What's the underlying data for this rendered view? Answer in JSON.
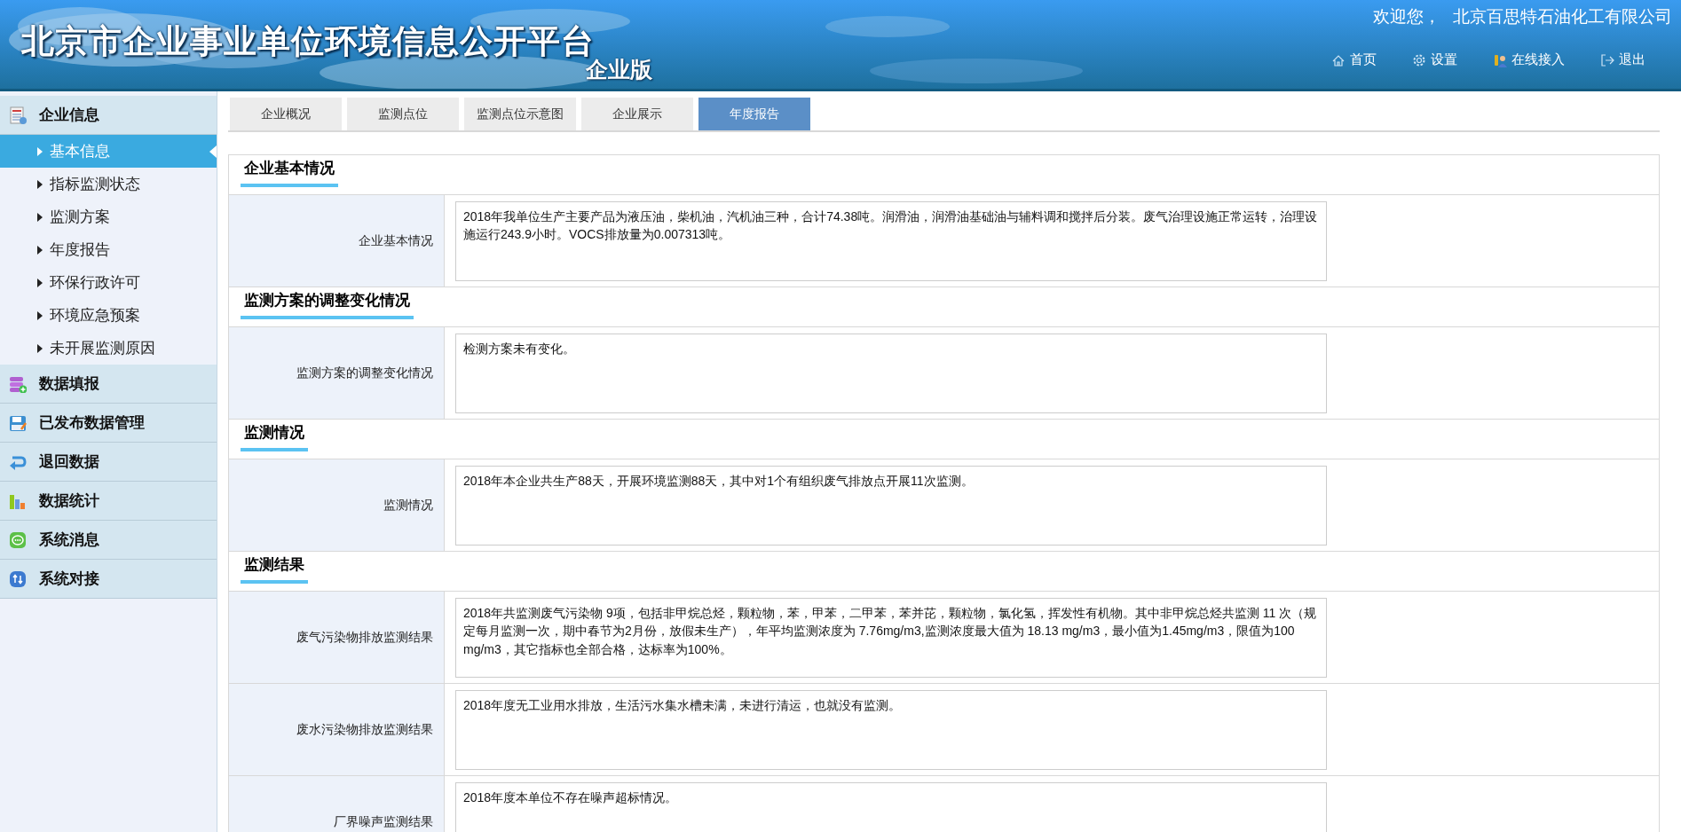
{
  "header": {
    "title": "北京市企业事业单位环境信息公开平台",
    "edition": "企业版",
    "welcome": "欢迎您，",
    "company": "北京百思特石油化工有限公司",
    "nav": [
      {
        "label": "首页"
      },
      {
        "label": "设置"
      },
      {
        "label": "在线接入"
      },
      {
        "label": "退出"
      }
    ]
  },
  "sidebar": {
    "groups": [
      {
        "label": "企业信息",
        "children": [
          {
            "label": "基本信息",
            "selected": true
          },
          {
            "label": "指标监测状态",
            "selected": false
          },
          {
            "label": "监测方案",
            "selected": false
          },
          {
            "label": "年度报告",
            "selected": false
          },
          {
            "label": "环保行政许可",
            "selected": false
          },
          {
            "label": "环境应急预案",
            "selected": false
          },
          {
            "label": "未开展监测原因",
            "selected": false
          }
        ]
      },
      {
        "label": "数据填报"
      },
      {
        "label": "已发布数据管理"
      },
      {
        "label": "退回数据"
      },
      {
        "label": "数据统计"
      },
      {
        "label": "系统消息"
      },
      {
        "label": "系统对接"
      }
    ]
  },
  "tabs": [
    {
      "label": "企业概况",
      "selected": false
    },
    {
      "label": "监测点位",
      "selected": false
    },
    {
      "label": "监测点位示意图",
      "selected": false
    },
    {
      "label": "企业展示",
      "selected": false
    },
    {
      "label": "年度报告",
      "selected": true
    }
  ],
  "sections": [
    {
      "title": "企业基本情况",
      "fields": [
        {
          "label": "企业基本情况",
          "value": "2018年我单位生产主要产品为液压油，柴机油，汽机油三种，合计74.38吨。润滑油，润滑油基础油与辅料调和搅拌后分装。废气治理设施正常运转，治理设施运行243.9小时。VOCS排放量为0.007313吨。"
        }
      ]
    },
    {
      "title": "监测方案的调整变化情况",
      "fields": [
        {
          "label": "监测方案的调整变化情况",
          "value": "检测方案未有变化。"
        }
      ]
    },
    {
      "title": "监测情况",
      "fields": [
        {
          "label": "监测情况",
          "value": "2018年本企业共生产88天，开展环境监测88天，其中对1个有组织废气排放点开展11次监测。"
        }
      ]
    },
    {
      "title": "监测结果",
      "fields": [
        {
          "label": "废气污染物排放监测结果",
          "value": "2018年共监测废气污染物 9项，包括非甲烷总烃，颗粒物，苯，甲苯，二甲苯，苯并芘，颗粒物，氯化氢，挥发性有机物。其中非甲烷总烃共监测 11 次（规定每月监测一次，期中春节为2月份，放假未生产），年平均监测浓度为  7.76mg/m3,监测浓度最大值为 18.13  mg/m3，最小值为1.45mg/m3，限值为100 mg/m3，其它指标也全部合格，达标率为100%。"
        },
        {
          "label": "废水污染物排放监测结果",
          "value": "2018年度无工业用水排放，生活污水集水槽未满，未进行清运，也就没有监测。"
        },
        {
          "label": "厂界噪声监测结果",
          "value": "2018年度本单位不存在噪声超标情况。"
        }
      ]
    }
  ]
}
